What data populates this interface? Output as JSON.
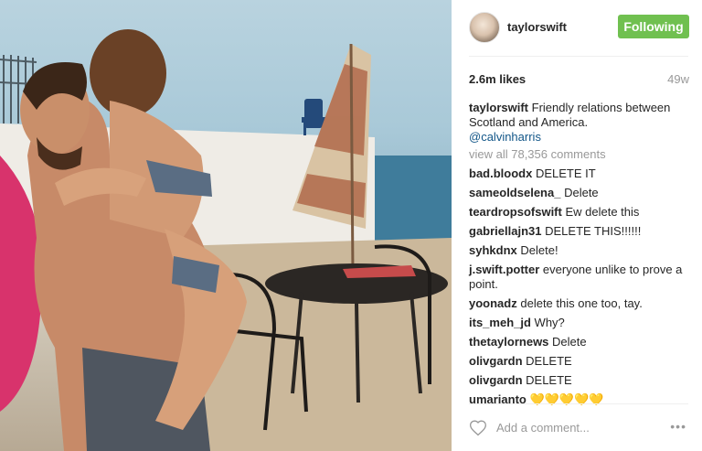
{
  "post": {
    "username": "taylorswift",
    "follow_label": "Following",
    "likes": "2.6m likes",
    "age": "49w",
    "caption_text": "Friendly relations between Scotland and America.",
    "caption_mention": "@calvinharris",
    "view_all": "view all 78,356 comments",
    "add_comment_placeholder": "Add a comment...",
    "more_label": "•••"
  },
  "comments": [
    {
      "user": "bad.bloodx",
      "text": "DELETE IT"
    },
    {
      "user": "sameoldselena_",
      "text": "Delete"
    },
    {
      "user": "teardropsofswift",
      "text": "Ew delete this"
    },
    {
      "user": "gabriellajn31",
      "text": "DELETE THIS!!!!!!"
    },
    {
      "user": "syhkdnx",
      "text": "Delete!"
    },
    {
      "user": "j.swift.potter",
      "text": "everyone unlike to prove a point."
    },
    {
      "user": "yoonadz",
      "text": "delete this one too, tay."
    },
    {
      "user": "its_meh_jd",
      "text": "Why?"
    },
    {
      "user": "thetaylornews",
      "text": "Delete"
    },
    {
      "user": "olivgardn",
      "text": "DELETE"
    },
    {
      "user": "olivgardn",
      "text": "DELETE"
    },
    {
      "user": "umarianto",
      "text": "💛💛💛💛💛"
    }
  ],
  "colors": {
    "follow_green": "#70c050",
    "mention_blue": "#125688",
    "muted_gray": "#999999"
  },
  "icons": [
    "heart-icon",
    "more-options-icon"
  ]
}
